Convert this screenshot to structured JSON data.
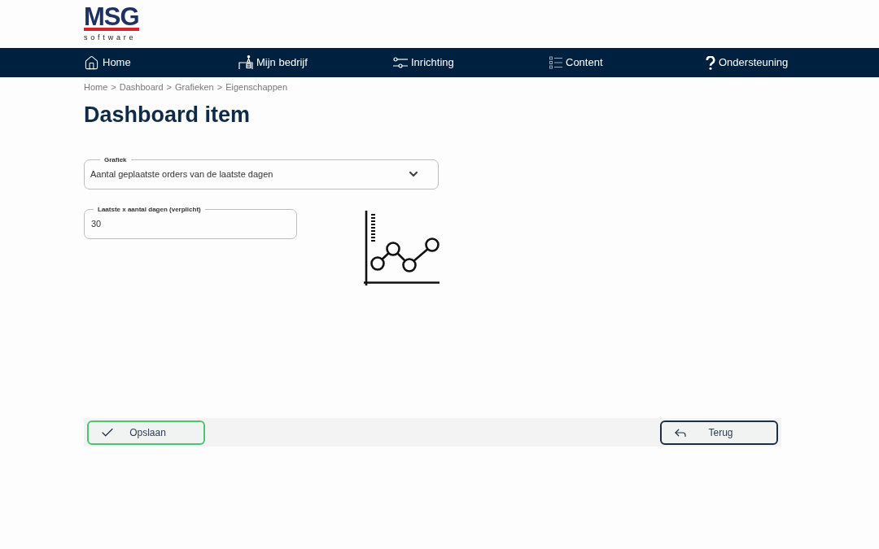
{
  "logo": {
    "wordmark": "MSG",
    "tagline": "software"
  },
  "nav": [
    {
      "label": "Home",
      "kind": "home"
    },
    {
      "label": "Mijn bedrijf",
      "kind": "company"
    },
    {
      "label": "Inrichting",
      "kind": "settings"
    },
    {
      "label": "Content",
      "kind": "content"
    },
    {
      "label": "Ondersteuning",
      "kind": "support"
    }
  ],
  "breadcrumb": {
    "items": [
      "Home",
      "Dashboard",
      "Grafieken",
      "Eigenschappen"
    ],
    "separator": ">"
  },
  "title": "Dashboard item",
  "form": {
    "chart_select": {
      "label": "Grafiek",
      "value": "Aantal geplaatste orders van de laatste dagen"
    },
    "days_field": {
      "label": "Laatste x aantal dagen (verplicht)",
      "value": "30"
    }
  },
  "footer": {
    "buttons": [
      {
        "label": "Opslaan",
        "kind": "save"
      },
      {
        "label": "Terug",
        "kind": "back"
      }
    ]
  }
}
